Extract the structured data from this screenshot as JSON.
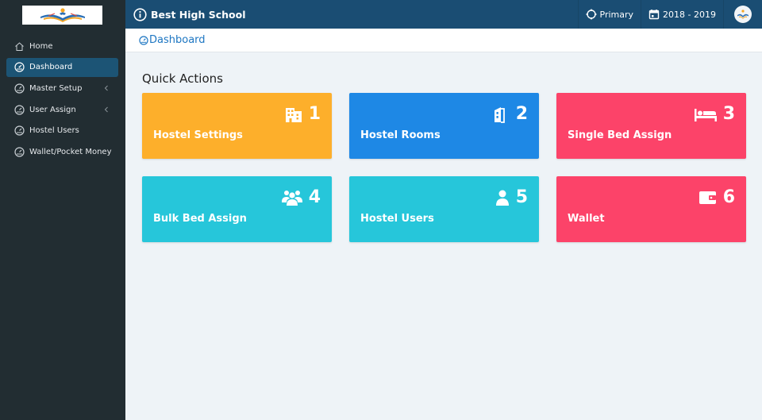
{
  "topbar": {
    "school_name": "Best High School",
    "level": "Primary",
    "year": "2018 - 2019"
  },
  "sidebar": {
    "items": [
      {
        "label": "Home",
        "icon": "home-icon"
      },
      {
        "label": "Dashboard",
        "icon": "dashboard-icon",
        "active": true
      },
      {
        "label": "Master Setup",
        "icon": "dashboard-icon",
        "has_children": true
      },
      {
        "label": "User Assign",
        "icon": "dashboard-icon",
        "has_children": true
      },
      {
        "label": "Hostel Users",
        "icon": "dashboard-icon"
      },
      {
        "label": "Wallet/Pocket Money",
        "icon": "dashboard-icon"
      }
    ]
  },
  "breadcrumb": "Dashboard",
  "quick_actions": {
    "title": "Quick Actions",
    "cards": [
      {
        "number": "1",
        "label": "Hostel Settings",
        "icon": "building-icon",
        "color": "#fdaf2b"
      },
      {
        "number": "2",
        "label": "Hostel Rooms",
        "icon": "door-icon",
        "color": "#1e88e5"
      },
      {
        "number": "3",
        "label": "Single Bed Assign",
        "icon": "bed-icon",
        "color": "#fc4369"
      },
      {
        "number": "4",
        "label": "Bulk Bed Assign",
        "icon": "users-icon",
        "color": "#26c6da"
      },
      {
        "number": "5",
        "label": "Hostel Users",
        "icon": "user-icon",
        "color": "#26c6da"
      },
      {
        "number": "6",
        "label": "Wallet",
        "icon": "wallet-icon",
        "color": "#fc4369"
      }
    ]
  }
}
